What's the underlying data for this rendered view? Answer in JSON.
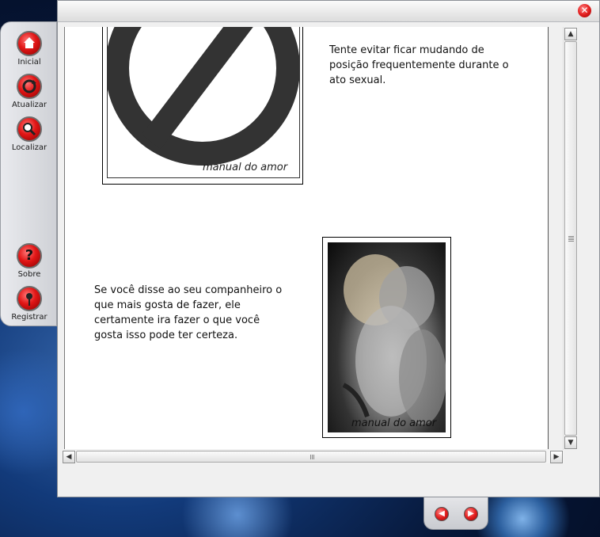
{
  "sidebar": {
    "items": [
      {
        "label": "Inicial",
        "icon": "home-icon"
      },
      {
        "label": "Atualizar",
        "icon": "refresh-icon"
      },
      {
        "label": "Localizar",
        "icon": "magnifier-icon"
      },
      {
        "label": "Sobre",
        "icon": "question-icon"
      },
      {
        "label": "Registrar",
        "icon": "pin-icon"
      }
    ]
  },
  "window": {
    "close_icon": "close-icon"
  },
  "content": {
    "paragraph1": "Tente evitar ficar mudando de posição frequentemente durante o ato sexual.",
    "paragraph2": "Se você disse ao seu companheiro o que mais gosta de fazer, ele certamente ira fazer o que você gosta isso pode ter certeza.",
    "watermark1": "manual do amor",
    "watermark2": "manual do amor"
  },
  "scrollbars": {
    "up_arrow": "▲",
    "down_arrow": "▼",
    "left_arrow": "◀",
    "right_arrow": "▶"
  },
  "nav": {
    "prev_icon": "arrow-left-icon",
    "next_icon": "arrow-right-icon"
  },
  "colors": {
    "accent_red": "#e11616",
    "window_bg": "#f0f0f0"
  }
}
